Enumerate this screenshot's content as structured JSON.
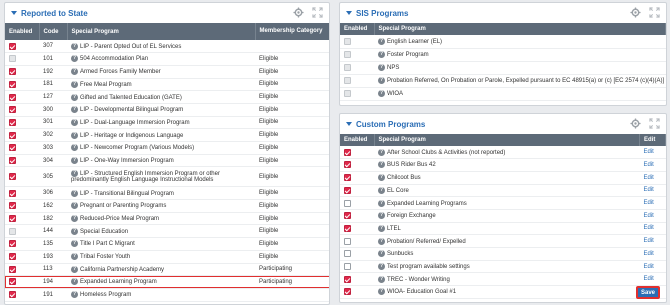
{
  "reported": {
    "title": "Reported to State",
    "columns": [
      "Enabled",
      "Code",
      "Special Program",
      "Membership Category"
    ],
    "rows": [
      {
        "enabled": true,
        "code": "307",
        "program": "LIP - Parent Opted Out of EL Services",
        "category": "",
        "help": true
      },
      {
        "enabled": false,
        "disabled": true,
        "code": "101",
        "program": "504 Accommodation Plan",
        "category": "Eligible",
        "help": true
      },
      {
        "enabled": true,
        "code": "192",
        "program": "Armed Forces Family Member",
        "category": "Eligible",
        "help": true
      },
      {
        "enabled": true,
        "code": "181",
        "program": "Free Meal Program",
        "category": "Eligible",
        "help": true
      },
      {
        "enabled": true,
        "code": "127",
        "program": "Gifted and Talented Education (GATE)",
        "category": "Eligible",
        "help": true
      },
      {
        "enabled": true,
        "code": "300",
        "program": "LIP - Developmental Bilingual Program",
        "category": "Eligible",
        "help": true
      },
      {
        "enabled": true,
        "code": "301",
        "program": "LIP - Dual-Language Immersion Program",
        "category": "Eligible",
        "help": true
      },
      {
        "enabled": true,
        "code": "302",
        "program": "LIP - Heritage or Indigenous Language",
        "category": "Eligible",
        "help": true
      },
      {
        "enabled": true,
        "code": "303",
        "program": "LIP - Newcomer Program (Various Models)",
        "category": "Eligible",
        "help": true
      },
      {
        "enabled": true,
        "code": "304",
        "program": "LIP - One-Way Immersion Program",
        "category": "Eligible",
        "help": true
      },
      {
        "enabled": true,
        "code": "305",
        "program": "LIP - Structured English Immersion Program or other predominantly English Language Instructional Models",
        "category": "Eligible",
        "help": true,
        "tall": true
      },
      {
        "enabled": true,
        "code": "306",
        "program": "LIP - Transitional Bilingual Program",
        "category": "Eligible",
        "help": true
      },
      {
        "enabled": true,
        "code": "162",
        "program": "Pregnant or Parenting Programs",
        "category": "Eligible",
        "help": true
      },
      {
        "enabled": true,
        "code": "182",
        "program": "Reduced-Price Meal Program",
        "category": "Eligible",
        "help": true
      },
      {
        "enabled": false,
        "disabled": true,
        "code": "144",
        "program": "Special Education",
        "category": "Eligible",
        "help": true
      },
      {
        "enabled": true,
        "code": "135",
        "program": "Title I Part C Migrant",
        "category": "Eligible",
        "help": true
      },
      {
        "enabled": true,
        "code": "193",
        "program": "Tribal Foster Youth",
        "category": "Eligible",
        "help": true
      },
      {
        "enabled": true,
        "code": "113",
        "program": "California Partnership Academy",
        "category": "Participating",
        "help": true
      },
      {
        "enabled": true,
        "code": "194",
        "program": "Expanded Learning Program",
        "category": "Participating",
        "help": true,
        "highlight": true
      },
      {
        "enabled": true,
        "code": "191",
        "program": "Homeless Program",
        "category": "",
        "help": true
      }
    ]
  },
  "sis": {
    "title": "SIS Programs",
    "columns": [
      "Enabled",
      "Special Program"
    ],
    "rows": [
      {
        "program": "English Learner (EL)"
      },
      {
        "program": "Foster Program"
      },
      {
        "program": "NPS"
      },
      {
        "program": "Probation Referred, On Probation or Parole, Expelled pursuant to EC 48915(a) or (c) [EC 2574 (c)(4)(A)]"
      },
      {
        "program": "WIOA"
      }
    ]
  },
  "custom": {
    "title": "Custom Programs",
    "columns": [
      "Enabled",
      "Special Program",
      "Edit"
    ],
    "edit_label": "Edit",
    "save_label": "Save",
    "rows": [
      {
        "enabled": true,
        "program": "After School Clubs & Activities (not reported)"
      },
      {
        "enabled": true,
        "program": "BUS Rider Bus 42"
      },
      {
        "enabled": true,
        "program": "Chilcoot Bus"
      },
      {
        "enabled": true,
        "program": "EL Core"
      },
      {
        "enabled": false,
        "program": "Expanded Learning Programs"
      },
      {
        "enabled": true,
        "program": "Foreign Exchange"
      },
      {
        "enabled": true,
        "program": "LTEL"
      },
      {
        "enabled": false,
        "program": "Probation/ Referred/ Expelled"
      },
      {
        "enabled": false,
        "program": "Sunbucks"
      },
      {
        "enabled": false,
        "program": "Test program available settings"
      },
      {
        "enabled": true,
        "program": "TREC - Wonder Writing"
      },
      {
        "enabled": true,
        "program": "WIOA- Education Goal #1"
      }
    ]
  },
  "icons": [
    "gear-icon",
    "expand-icon",
    "help-icon",
    "collapse-triangle-icon"
  ],
  "colors": {
    "accent": "#2a6db5",
    "checkbox_on": "#e0284a",
    "header_bg": "#5d6a78",
    "highlight": "#e02f2f"
  }
}
